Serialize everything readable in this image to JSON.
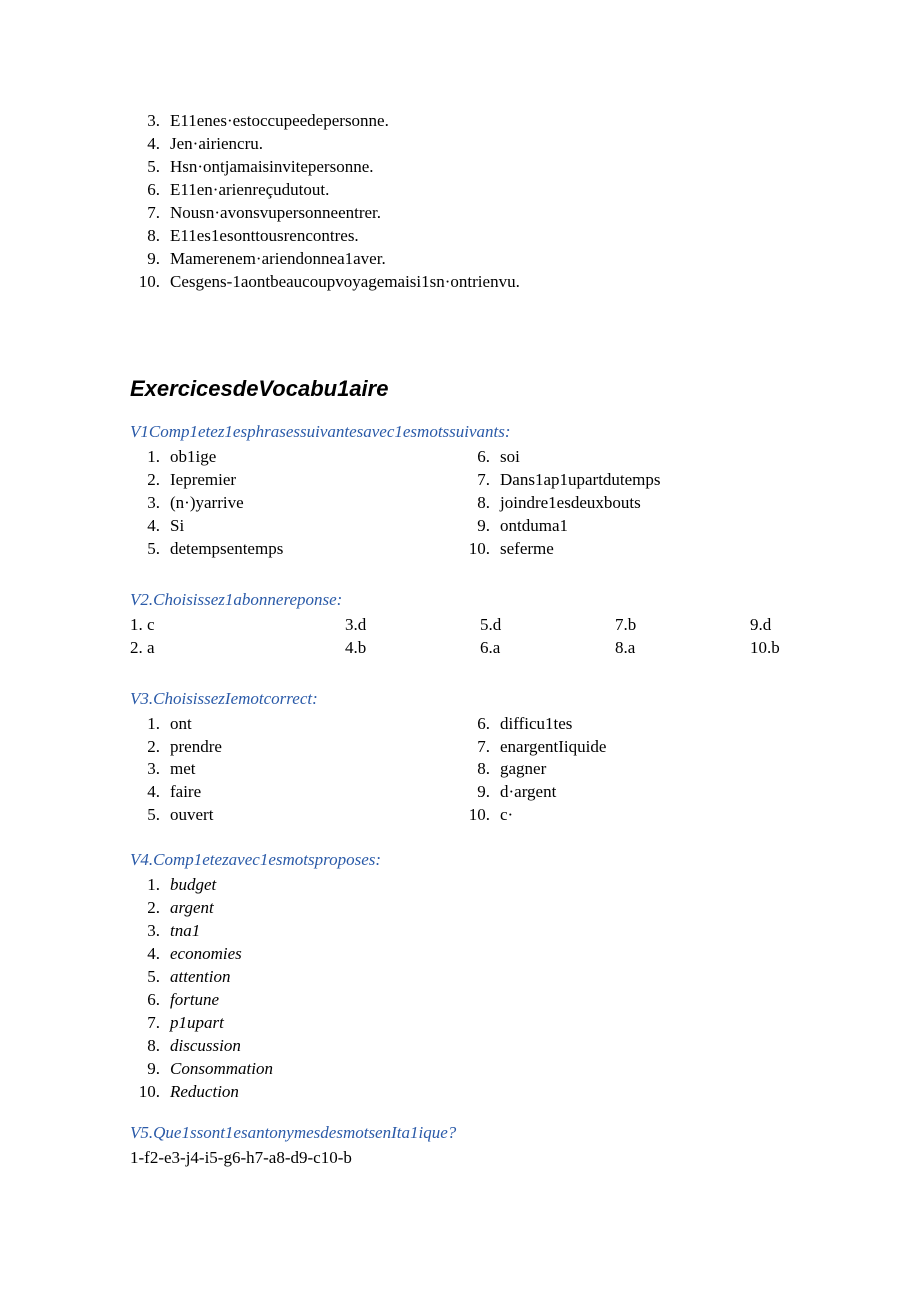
{
  "topList": [
    {
      "n": "3.",
      "t": "E11enes·estoccupeedepersonne."
    },
    {
      "n": "4.",
      "t": "Jen·airiencru."
    },
    {
      "n": "5.",
      "t": "Hsn·ontjamaisinvitepersonne."
    },
    {
      "n": "6.",
      "t": "E11en·arienreçudutout."
    },
    {
      "n": "7.",
      "t": "Nousn·avonsvupersonneentrer."
    },
    {
      "n": "8.",
      "t": "E11es1esonttousrencontres."
    },
    {
      "n": "9.",
      "t": "Mamerenem·ariendonnea1aver."
    },
    {
      "n": "10.",
      "t": " Cesgens-1aontbeaucoupvoyagemaisi1sn·ontrienvu."
    }
  ],
  "sectionTitle": "ExercicesdeVocabu1aire",
  "v1": {
    "heading": "V1Comp1etez1esphrasessuivantesavec1esmotssuivants:",
    "left": [
      {
        "n": "1.",
        "t": "ob1ige"
      },
      {
        "n": "2.",
        "t": "Iepremier"
      },
      {
        "n": "3.",
        "t": "(n·)yarrive"
      },
      {
        "n": "4.",
        "t": "Si"
      },
      {
        "n": "5.",
        "t": "detempsentemps"
      }
    ],
    "right": [
      {
        "n": "6.",
        "t": " soi"
      },
      {
        "n": "7.",
        "t": " Dans1ap1upartdutemps"
      },
      {
        "n": "8.",
        "t": " joindre1esdeuxbouts"
      },
      {
        "n": "9.",
        "t": " ontduma1"
      },
      {
        "n": "10.",
        "t": "seferme"
      }
    ]
  },
  "v2": {
    "heading": "V2.Choisissez1abonnereponse:",
    "row1": [
      "1. c",
      "3.d",
      "5.d",
      "7.b",
      "9.d"
    ],
    "row2": [
      "2. a",
      "4.b",
      "6.a",
      "8.a",
      "10.b"
    ]
  },
  "v3": {
    "heading": "V3.ChoisissezIemotcorrect:",
    "left": [
      {
        "n": "1.",
        "t": "ont"
      },
      {
        "n": "2.",
        "t": "prendre"
      },
      {
        "n": "3.",
        "t": "met"
      },
      {
        "n": "4.",
        "t": "faire"
      },
      {
        "n": "5.",
        "t": "ouvert"
      }
    ],
    "right": [
      {
        "n": "6.",
        "t": " difficu1tes"
      },
      {
        "n": "7.",
        "t": " enargentIiquide"
      },
      {
        "n": "8.",
        "t": " gagner"
      },
      {
        "n": "9.",
        "t": " d·argent"
      },
      {
        "n": "10.",
        "t": "c·"
      }
    ]
  },
  "v4": {
    "heading": "V4.Comp1etezavec1esmotsproposes:",
    "items": [
      {
        "n": "1.",
        "t": " budget"
      },
      {
        "n": "2.",
        "t": " argent"
      },
      {
        "n": "3.",
        "t": " tna1"
      },
      {
        "n": "4.",
        "t": " economies"
      },
      {
        "n": "5.",
        "t": " attention"
      },
      {
        "n": "6.",
        "t": " fortune"
      },
      {
        "n": "7.",
        "t": " p1upart"
      },
      {
        "n": "8.",
        "t": " discussion"
      },
      {
        "n": "9.",
        "t": " Consommation"
      },
      {
        "n": "10.",
        "t": "  Reduction"
      }
    ]
  },
  "v5": {
    "heading": "V5.Que1ssont1esantonymesdesmotsenIta1ique?",
    "line": "1-f2-e3-j4-i5-g6-h7-a8-d9-c10-b"
  }
}
